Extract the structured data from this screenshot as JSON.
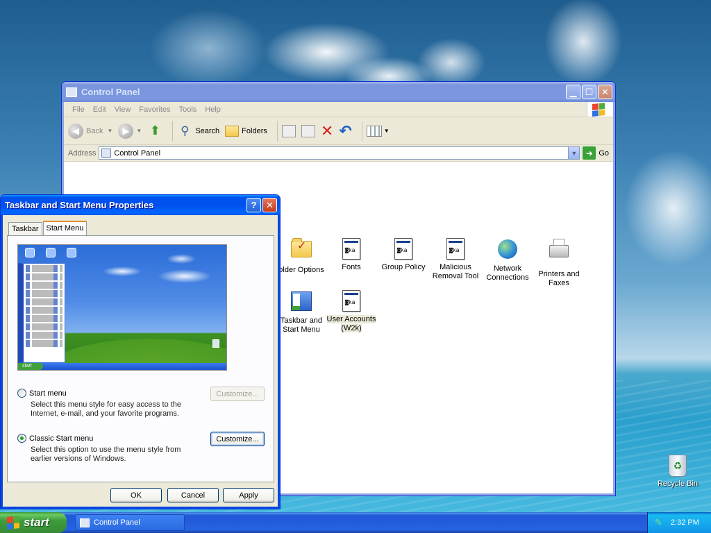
{
  "desktop": {
    "recycle_bin_label": "Recycle Bin"
  },
  "control_panel": {
    "title": "Control Panel",
    "menu": [
      "File",
      "Edit",
      "View",
      "Favorites",
      "Tools",
      "Help"
    ],
    "toolbar": {
      "back": "Back",
      "search": "Search",
      "folders": "Folders"
    },
    "address": {
      "label": "Address",
      "value": "Control Panel",
      "go": "Go"
    },
    "items": [
      {
        "label": "older Options",
        "icon": "folder-options-icon"
      },
      {
        "label": "Fonts",
        "icon": "fonts-icon"
      },
      {
        "label": "Group Policy",
        "icon": "group-policy-icon"
      },
      {
        "label": "Malicious Removal Tool",
        "icon": "malicious-removal-tool-icon"
      },
      {
        "label": "Network Connections",
        "icon": "network-connections-icon"
      },
      {
        "label": "Printers and Faxes",
        "icon": "printers-faxes-icon"
      },
      {
        "label": "Taskbar and Start Menu",
        "icon": "taskbar-start-menu-icon"
      },
      {
        "label": "User Accounts (W2k)",
        "icon": "user-accounts-icon"
      }
    ]
  },
  "dialog": {
    "title": "Taskbar and Start Menu Properties",
    "help_button": "?",
    "tabs": [
      {
        "label": "Taskbar",
        "active": false
      },
      {
        "label": "Start Menu",
        "active": true
      }
    ],
    "options": [
      {
        "label": "Start menu",
        "selected": false,
        "description": "Select this menu style for easy access to the Internet, e-mail, and your favorite programs.",
        "customize": "Customize...",
        "customize_enabled": false
      },
      {
        "label": "Classic Start menu",
        "selected": true,
        "description": "Select this option to use the menu style from earlier versions of Windows.",
        "customize": "Customize...",
        "customize_enabled": true
      }
    ],
    "preview_start_label": "start",
    "buttons": {
      "ok": "OK",
      "cancel": "Cancel",
      "apply": "Apply"
    }
  },
  "taskbar": {
    "start_label": "start",
    "tasks": [
      {
        "label": "Control Panel"
      }
    ],
    "clock": "2:32 PM"
  },
  "colors": {
    "title_active": "#0053ee",
    "taskbar": "#2663e0",
    "start_button": "#3e9b3c"
  }
}
